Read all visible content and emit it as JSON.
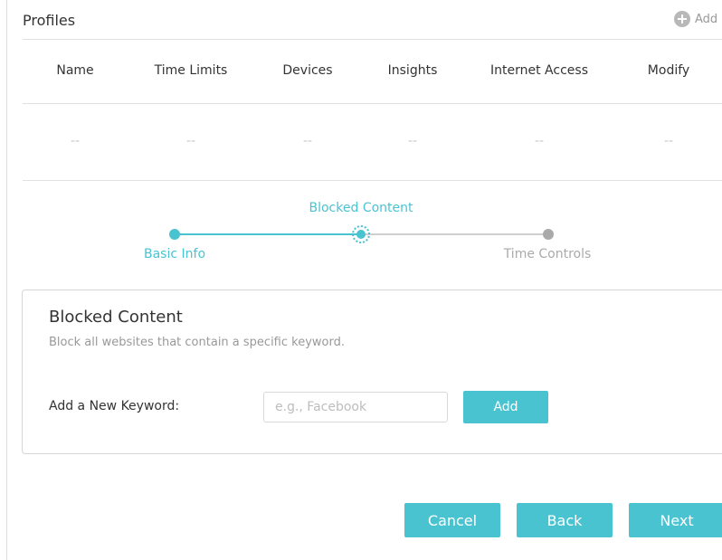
{
  "colors": {
    "accent": "#4ac3d1",
    "inactive": "#aaaaaa",
    "muted_text": "#999999"
  },
  "profiles": {
    "title": "Profiles",
    "add_label": "Add",
    "add_icon": "plus-circle-icon",
    "columns": [
      "Name",
      "Time Limits",
      "Devices",
      "Insights",
      "Internet Access",
      "Modify"
    ],
    "rows": [
      [
        "--",
        "--",
        "--",
        "--",
        "--",
        "--"
      ]
    ]
  },
  "stepper": {
    "steps": [
      {
        "label": "Basic Info",
        "state": "done"
      },
      {
        "label": "Blocked Content",
        "state": "current"
      },
      {
        "label": "Time Controls",
        "state": "upcoming"
      }
    ]
  },
  "blocked_content": {
    "title": "Blocked Content",
    "description": "Block all websites that contain a specific keyword.",
    "keyword_label": "Add a New Keyword:",
    "keyword_placeholder": "e.g., Facebook",
    "keyword_value": "",
    "add_button": "Add"
  },
  "footer": {
    "cancel": "Cancel",
    "back": "Back",
    "next": "Next"
  }
}
